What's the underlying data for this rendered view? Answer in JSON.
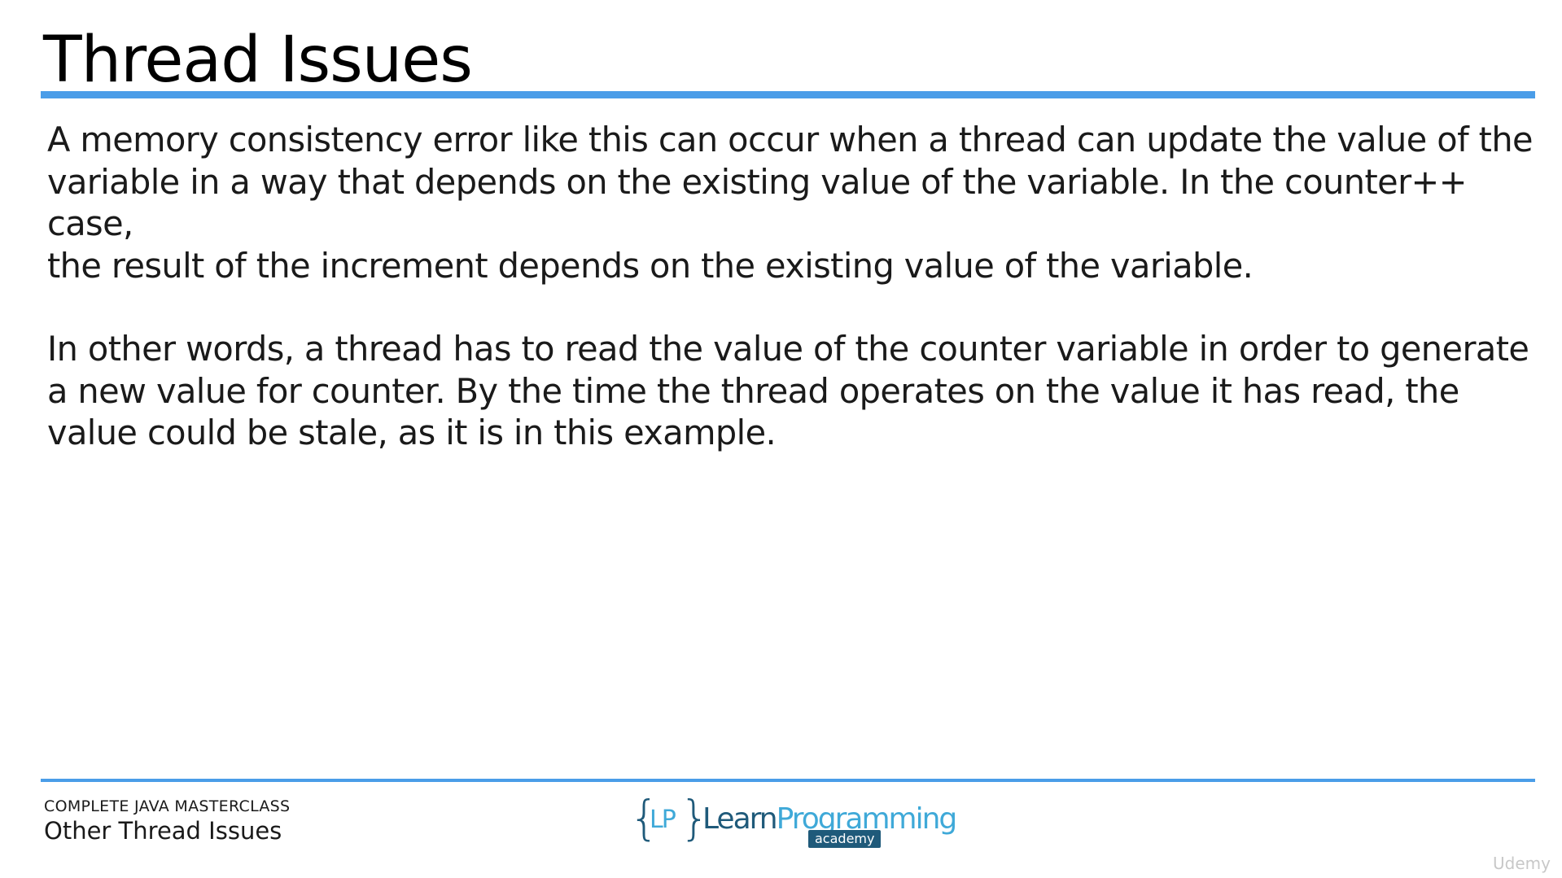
{
  "slide": {
    "title": "Thread Issues",
    "paragraphs": [
      {
        "lines": [
          "A memory consistency error like this can occur when a thread can update the value of the",
          "variable in a way that depends on the existing value of the variable. In the counter++ case,",
          "the result of the increment depends on the existing value of the variable."
        ]
      },
      {
        "lines": [
          "In other words, a thread has to read the value of the counter variable in order to generate",
          "a new value for counter. By the time the thread operates on the value it has read, the",
          "value could be stale, as it is in this example."
        ]
      }
    ]
  },
  "footer": {
    "course": "COMPLETE JAVA MASTERCLASS",
    "section": "Other Thread Issues",
    "logo": {
      "brace_open": "{",
      "initials": "LP",
      "brace_close": "}",
      "name_part1": "Learn",
      "name_part2": "Programming",
      "tagline": "academy"
    },
    "watermark": "Udemy"
  },
  "colors": {
    "accent_rule": "#4a9de8",
    "logo_dark": "#1f5a7a",
    "logo_light": "#3fa9d8"
  }
}
